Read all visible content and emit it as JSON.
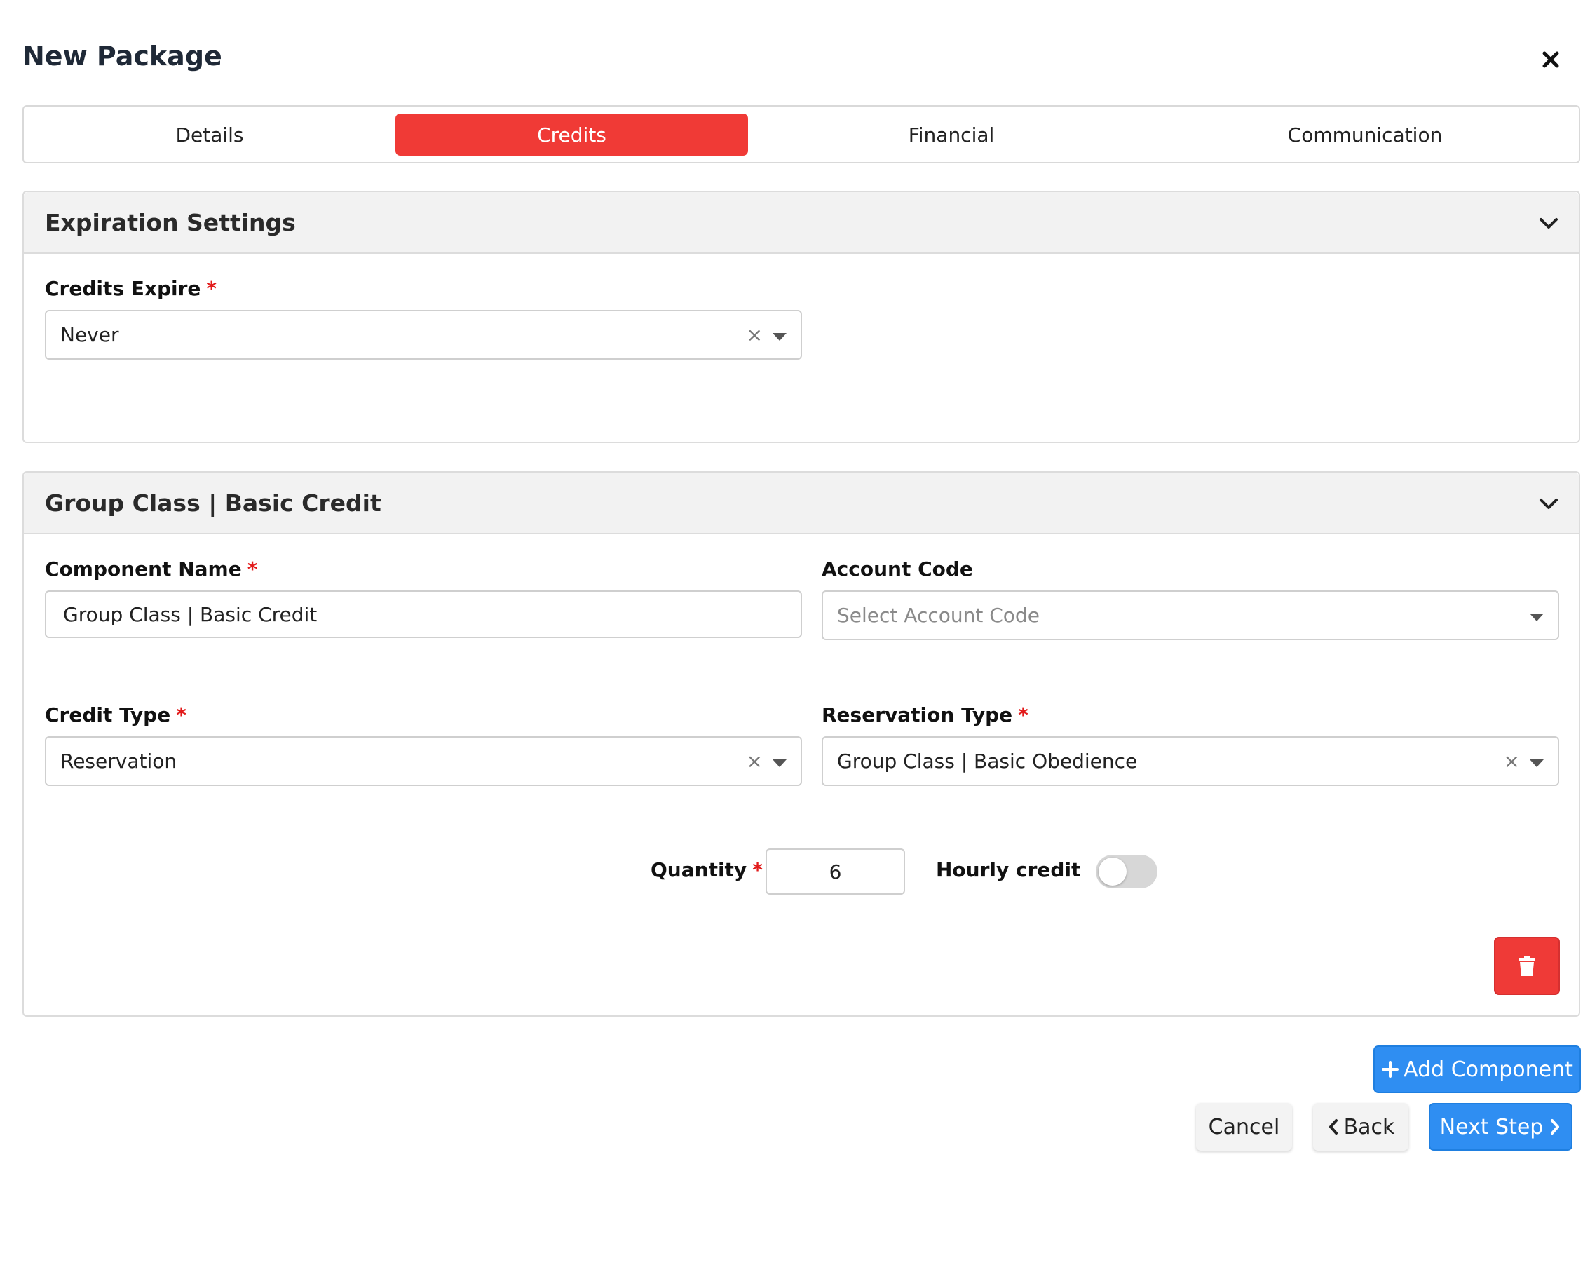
{
  "modal": {
    "title": "New Package"
  },
  "tabs": [
    {
      "label": "Details",
      "active": false
    },
    {
      "label": "Credits",
      "active": true
    },
    {
      "label": "Financial",
      "active": false
    },
    {
      "label": "Communication",
      "active": false
    }
  ],
  "expiration": {
    "title": "Expiration Settings",
    "credits_expire_label": "Credits Expire",
    "credits_expire_value": "Never"
  },
  "component": {
    "title": "Group Class | Basic Credit",
    "component_name_label": "Component Name",
    "component_name_value": "Group Class | Basic Credit",
    "account_code_label": "Account Code",
    "account_code_placeholder": "Select Account Code",
    "credit_type_label": "Credit Type",
    "credit_type_value": "Reservation",
    "reservation_type_label": "Reservation Type",
    "reservation_type_value": "Group Class | Basic Obedience",
    "quantity_label": "Quantity",
    "quantity_value": "6",
    "hourly_credit_label": "Hourly credit",
    "hourly_credit_on": false
  },
  "required_marker": "*",
  "clear_glyph": "×",
  "buttons": {
    "add_component": "Add Component",
    "cancel": "Cancel",
    "back": "Back",
    "next_step": "Next Step"
  },
  "icons": {
    "close": "close-icon",
    "chevron": "chevron-down-icon",
    "trash": "trash-icon",
    "plus": "plus-icon",
    "left": "chevron-left-icon",
    "right": "chevron-right-icon"
  },
  "colors": {
    "accent_red": "#f03a36",
    "primary_blue": "#2f8ef2",
    "required_red": "#e21b1b"
  }
}
